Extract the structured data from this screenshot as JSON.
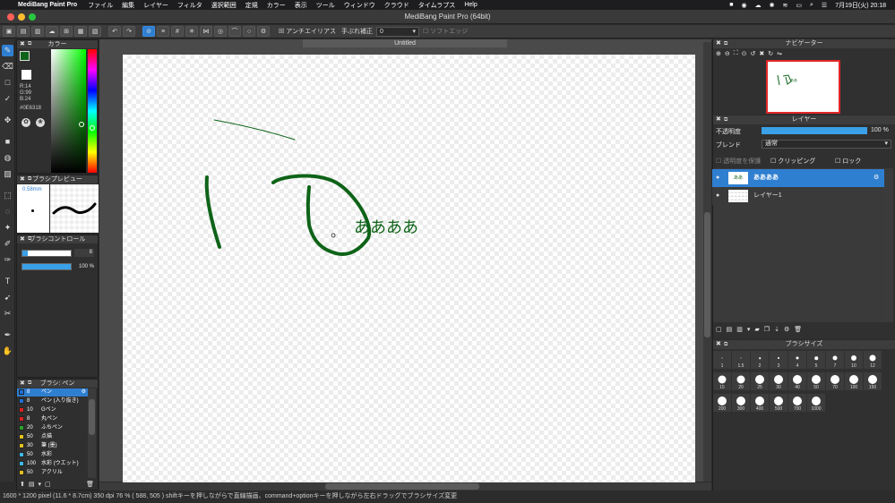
{
  "menubar": {
    "app_name": "MediBang Paint Pro",
    "items": [
      "ファイル",
      "編集",
      "レイヤー",
      "フィルタ",
      "選択範囲",
      "定規",
      "カラー",
      "表示",
      "ツール",
      "ウィンドウ",
      "クラウド",
      "タイムラプス",
      "Help"
    ],
    "date_time": "7月19日(火) 20:18"
  },
  "window": {
    "title": "MediBang Paint Pro (64bit)"
  },
  "toolbar": {
    "antialias_label": "アンチエイリアス",
    "stabilizer_label": "手ぶれ補正",
    "stabilizer_value": "0",
    "soft_edge_label": "ソフトエッジ"
  },
  "document": {
    "tab_title": "Untitled"
  },
  "color_panel": {
    "title": "カラー",
    "r": "R:14",
    "g": "G:99",
    "b": "B:24",
    "hex": "#0E6318",
    "current_color": "#0E6318"
  },
  "brush_preview": {
    "title": "ブラシプレビュー",
    "size": "0.58mm"
  },
  "brush_control": {
    "title": "ブラシコントロール",
    "size_value": "8",
    "opacity_value": "100 %"
  },
  "brush_list": {
    "title": "ブラシ: ペン",
    "items": [
      {
        "num": "8",
        "name": "ペン",
        "color": "#1e6fd6"
      },
      {
        "num": "8",
        "name": "ペン (入り抜き)",
        "color": "#1e6fd6"
      },
      {
        "num": "10",
        "name": "Gペン",
        "color": "#e02020"
      },
      {
        "num": "8",
        "name": "丸ペン",
        "color": "#e02020"
      },
      {
        "num": "20",
        "name": "ふちペン",
        "color": "#2aa52a"
      },
      {
        "num": "50",
        "name": "点描",
        "color": "#e0c020"
      },
      {
        "num": "30",
        "name": "筆 (墨)",
        "color": "#e0c020"
      },
      {
        "num": "50",
        "name": "水彩",
        "color": "#3fb7e8"
      },
      {
        "num": "100",
        "name": "水彩 (ウエット)",
        "color": "#3fb7e8"
      },
      {
        "num": "50",
        "name": "アクリル",
        "color": "#e0c020"
      }
    ]
  },
  "canvas": {
    "text": "ああああ",
    "stroke_color": "#0E6318"
  },
  "navigator": {
    "title": "ナビゲーター"
  },
  "layers": {
    "title": "レイヤー",
    "opacity_label": "不透明度",
    "opacity_value": "100 %",
    "opacity_fraction": 1.0,
    "blend_label": "ブレンド",
    "blend_value": "通常",
    "protect_label": "透明度を保護",
    "clipping_label": "クリッピング",
    "lock_label": "ロック",
    "items": [
      {
        "name": "ああああ",
        "selected": true
      },
      {
        "name": "レイヤー1",
        "selected": false
      }
    ]
  },
  "brush_size_panel": {
    "title": "ブラシサイズ",
    "sizes": [
      "1",
      "1.5",
      "2",
      "3",
      "4",
      "5",
      "7",
      "10",
      "12",
      "15",
      "20",
      "25",
      "30",
      "40",
      "50",
      "70",
      "100",
      "150",
      "200",
      "300",
      "400",
      "500",
      "700",
      "1000"
    ]
  },
  "statusbar": {
    "text": "1600 * 1200 pixel   (11.6 * 8.7cm)   350 dpi   76 %   ( 588, 505 )   shiftキーを押しながらで直線描画、command+optionキーを押しながら左右ドラッグでブラシサイズ変更"
  }
}
